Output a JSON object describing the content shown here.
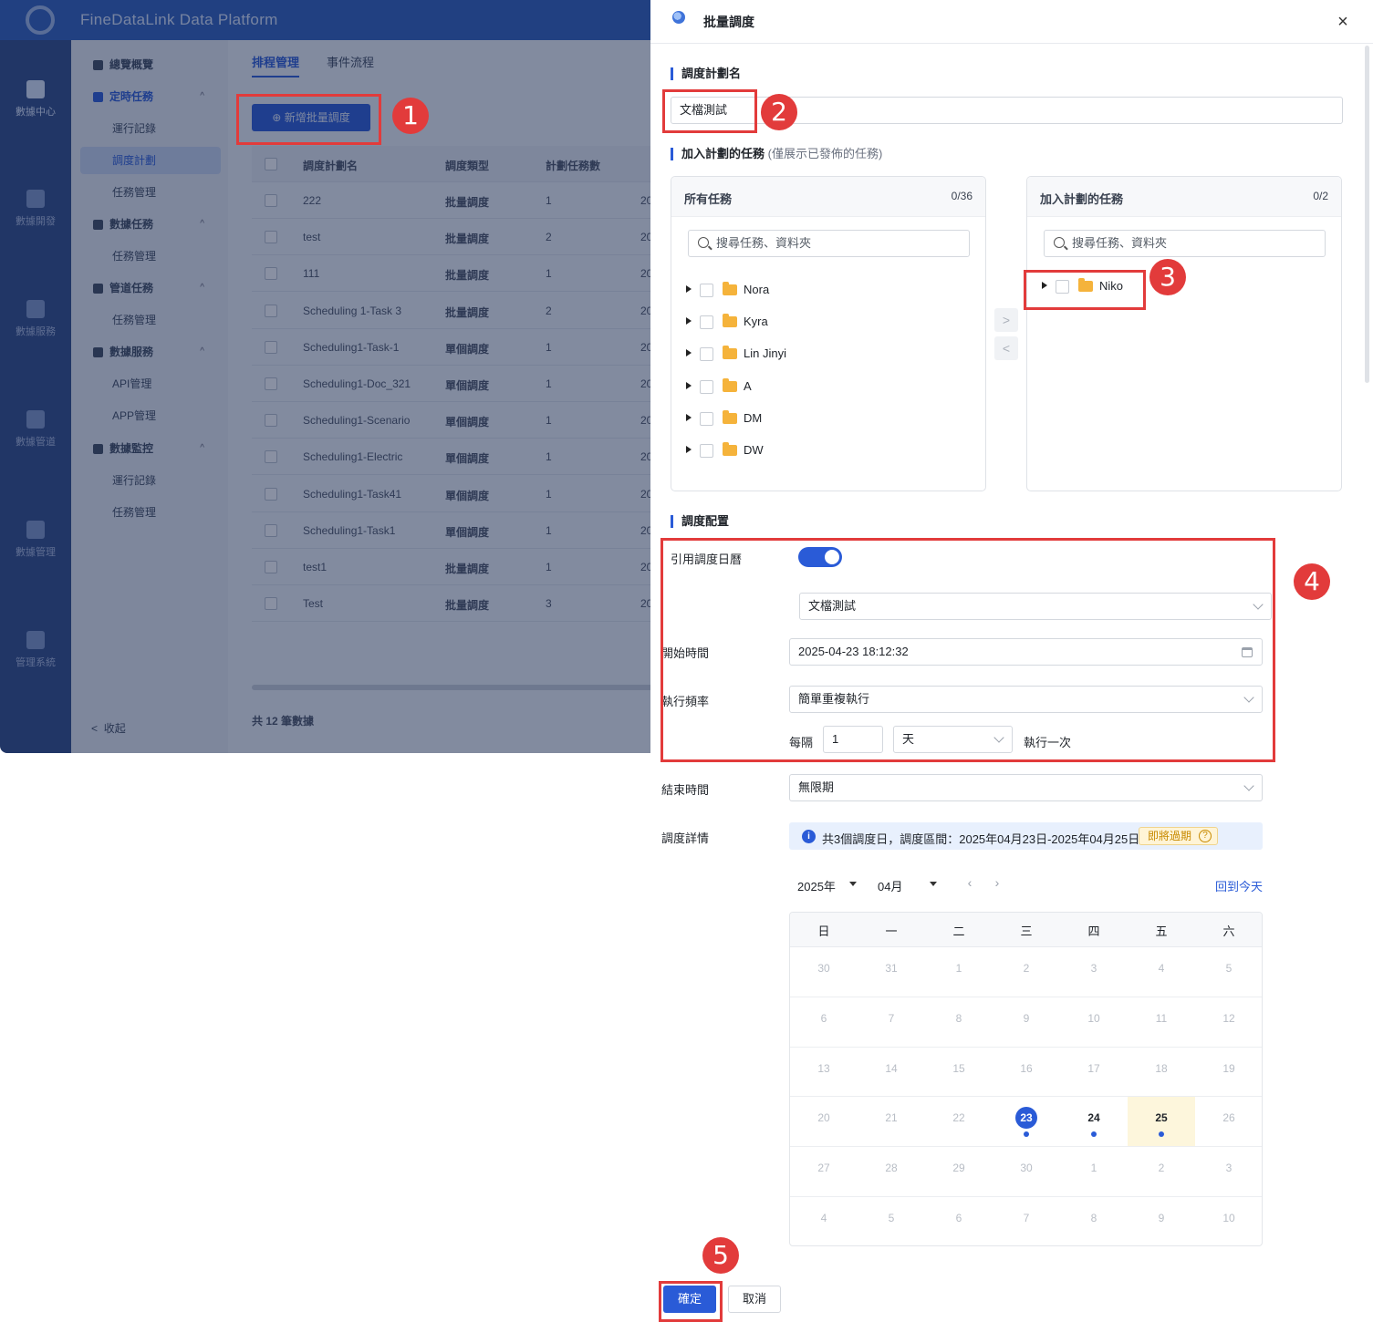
{
  "app": {
    "brand": "FineDataLink Data Platform",
    "rail": [
      "數據中心",
      "數據開發",
      "數據服務",
      "數據管道",
      "數據管理",
      "管理系統"
    ],
    "nav": [
      {
        "label": "總覽概覽",
        "type": "parent"
      },
      {
        "label": "定時任務",
        "type": "parent-blue"
      },
      {
        "label": "運行記錄",
        "type": "child"
      },
      {
        "label": "調度計劃",
        "type": "child-selected"
      },
      {
        "label": "任務管理",
        "type": "child"
      },
      {
        "label": "數據任務",
        "type": "parent"
      },
      {
        "label": "任務管理",
        "type": "child"
      },
      {
        "label": "管道任務",
        "type": "parent"
      },
      {
        "label": "任務管理",
        "type": "child"
      },
      {
        "label": "數據服務",
        "type": "parent"
      },
      {
        "label": "API管理",
        "type": "child"
      },
      {
        "label": "APP管理",
        "type": "child"
      },
      {
        "label": "數據監控",
        "type": "parent"
      },
      {
        "label": "運行記錄",
        "type": "child"
      },
      {
        "label": "任務管理",
        "type": "child"
      }
    ],
    "collapse_label": "收起",
    "tabs": [
      "排程管理",
      "事件流程"
    ],
    "add_button": "新增批量調度",
    "table_header": [
      "調度計劃名",
      "調度類型",
      "計劃任務數"
    ],
    "table_rows": [
      {
        "name": "222",
        "type": "批量調度",
        "count": "1"
      },
      {
        "name": "test",
        "type": "批量調度",
        "count": "2"
      },
      {
        "name": "111",
        "type": "批量調度",
        "count": "1"
      },
      {
        "name": "Scheduling 1-Task 3",
        "type": "批量調度",
        "count": "2"
      },
      {
        "name": "Scheduling1-Task-1",
        "type": "單個調度",
        "count": "1"
      },
      {
        "name": "Scheduling1-Doc_321",
        "type": "單個調度",
        "count": "1"
      },
      {
        "name": "Scheduling1-Scenario",
        "type": "單個調度",
        "count": "1"
      },
      {
        "name": "Scheduling1-Electric",
        "type": "單個調度",
        "count": "1"
      },
      {
        "name": "Scheduling1-Task41",
        "type": "單個調度",
        "count": "1"
      },
      {
        "name": "Scheduling1-Task1",
        "type": "單個調度",
        "count": "1"
      },
      {
        "name": "test1",
        "type": "批量調度",
        "count": "1"
      },
      {
        "name": "Test",
        "type": "批量調度",
        "count": "3"
      }
    ],
    "table_col4": "20",
    "footer_text": "共 12 筆數據"
  },
  "drawer": {
    "title": "批量調度",
    "close_glyph": "×",
    "plan_name_label": "調度計劃名",
    "plan_name_value": "文檔測試",
    "tasks_label": "加入計劃的任務",
    "tasks_hint": "(僅展示已發佈的任務)",
    "left_panel": {
      "title": "所有任務",
      "count": "0/36",
      "search_placeholder": "搜尋任務、資料夾",
      "items": [
        "Nora",
        "Kyra",
        "Lin Jinyi",
        "A",
        "DM",
        "DW"
      ]
    },
    "right_panel": {
      "title": "加入計劃的任務",
      "count": "0/2",
      "search_placeholder": "搜尋任務、資料夾",
      "items": [
        "Niko"
      ]
    },
    "move_right_glyph": ">",
    "move_left_glyph": "<",
    "config_label": "調度配置",
    "use_calendar_label": "引用調度日曆",
    "use_calendar_on": true,
    "calendar_select": "文檔測試",
    "start_time_label": "開始時間",
    "start_time_value": "2025-04-23 18:12:32",
    "frequency_label": "執行頻率",
    "frequency_value": "簡單重複執行",
    "every_label": "每隔",
    "every_value": "1",
    "unit_value": "天",
    "execute_once_label": "執行一次",
    "end_time_label": "結束時間",
    "end_time_value": "無限期",
    "detail_label": "調度詳情",
    "detail_text": "共3個調度日，調度區間：2025年04月23日-2025年04月25日",
    "expiring_badge": "即將過期",
    "year_value": "2025年",
    "month_value": "04月",
    "back_today": "回到今天",
    "weekdays": [
      "日",
      "一",
      "二",
      "三",
      "四",
      "五",
      "六"
    ],
    "weeks": [
      [
        "30",
        "31",
        "1",
        "2",
        "3",
        "4",
        "5"
      ],
      [
        "6",
        "7",
        "8",
        "9",
        "10",
        "11",
        "12"
      ],
      [
        "13",
        "14",
        "15",
        "16",
        "17",
        "18",
        "19"
      ],
      [
        "20",
        "21",
        "22",
        "23",
        "24",
        "25",
        "26"
      ],
      [
        "27",
        "28",
        "29",
        "30",
        "1",
        "2",
        "3"
      ],
      [
        "4",
        "5",
        "6",
        "7",
        "8",
        "9",
        "10"
      ]
    ],
    "scheduled_days": [
      "23",
      "24",
      "25"
    ],
    "today": "23",
    "ok_button": "確定",
    "cancel_button": "取消"
  },
  "annotations": [
    "1",
    "2",
    "3",
    "4",
    "5"
  ],
  "colors": {
    "accent": "#2a5bd7",
    "annotation": "#e23b3b",
    "highlight": "#fdf6dc"
  }
}
